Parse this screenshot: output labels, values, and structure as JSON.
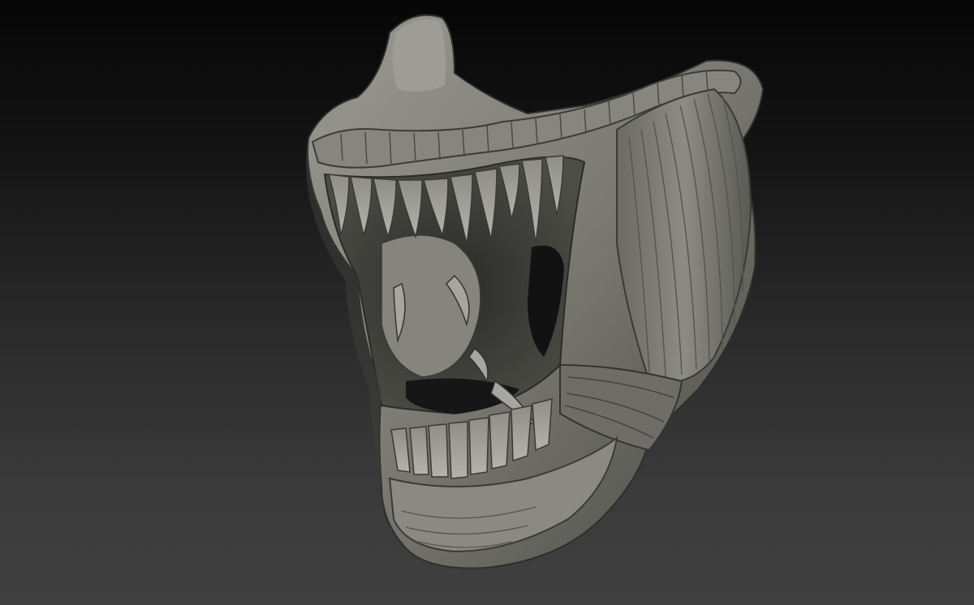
{
  "scene": {
    "subject": "sculpt-mesh",
    "background_top": "#060606",
    "background_bottom": "#404040",
    "clay_light": "#9a9a92",
    "clay_mid": "#74746c",
    "clay_dark": "#3a3a36",
    "cavity": "#141414"
  }
}
